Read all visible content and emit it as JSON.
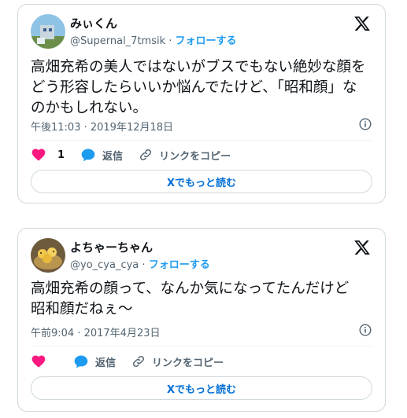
{
  "tweets": [
    {
      "display_name": "みぃくん",
      "handle": "@Supernal_7tmsik",
      "separator": "·",
      "follow_label": "フォローする",
      "text_lines": [
        "高畑充希の美人ではないがブスでもない絶妙な顔を",
        "どう形容したらいいか悩んでたけど、「昭和顔」な",
        "のかもしれない。"
      ],
      "timestamp": "午後11:03 · 2019年12月18日",
      "like_count": "1",
      "reply_label": "返信",
      "copy_link_label": "リンクをコピー",
      "read_more_label": "Xでもっと読む"
    },
    {
      "display_name": "よちゃーちゃん",
      "handle": "@yo_cya_cya",
      "separator": "·",
      "follow_label": "フォローする",
      "text_lines": [
        "高畑充希の顔って、なんか気になってたんだけど",
        "昭和顔だねぇ〜"
      ],
      "timestamp": "午前9:04 · 2017年4月23日",
      "like_count": "",
      "reply_label": "返信",
      "copy_link_label": "リンクをコピー",
      "read_more_label": "Xでもっと読む"
    }
  ],
  "colors": {
    "like": "#f91880",
    "reply": "#1d9bf0",
    "follow": "#1d9bf0",
    "read_more": "#006fd6",
    "border": "#cfd9de",
    "secondary_text": "#536471"
  },
  "icons": [
    "x-logo-icon",
    "info-icon",
    "heart-icon",
    "reply-bubble-icon",
    "link-icon"
  ]
}
